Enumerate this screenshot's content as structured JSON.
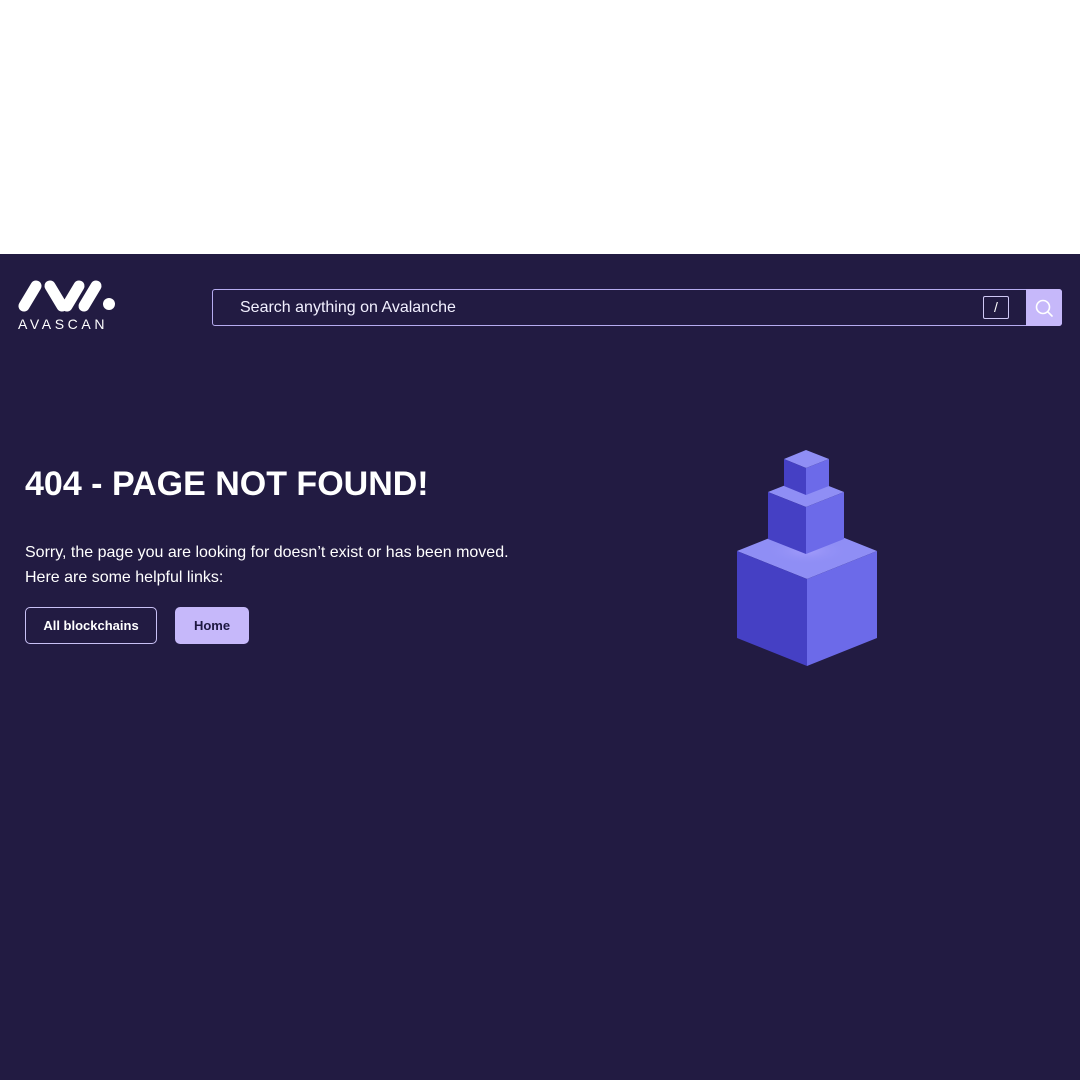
{
  "header": {
    "logo_text": "AVASCAN",
    "search": {
      "placeholder": "Search anything on Avalanche",
      "shortcut_key": "/"
    }
  },
  "main": {
    "title": "404 - PAGE NOT FOUND!",
    "description_lines": [
      "Sorry, the page you are looking for doesn’t exist or has been moved.",
      "Here are some helpful links:"
    ],
    "links": [
      {
        "label": "All blockchains"
      },
      {
        "label": "Home"
      }
    ]
  },
  "colors": {
    "background": "#221b42",
    "accent": "#c6b8fa",
    "cube_left": "#4540c4",
    "cube_right": "#6c6ae9",
    "cube_top": "#8f8ef5"
  },
  "icons": {
    "search_button": "search-icon",
    "illustration": "stacked-cubes-illustration"
  }
}
